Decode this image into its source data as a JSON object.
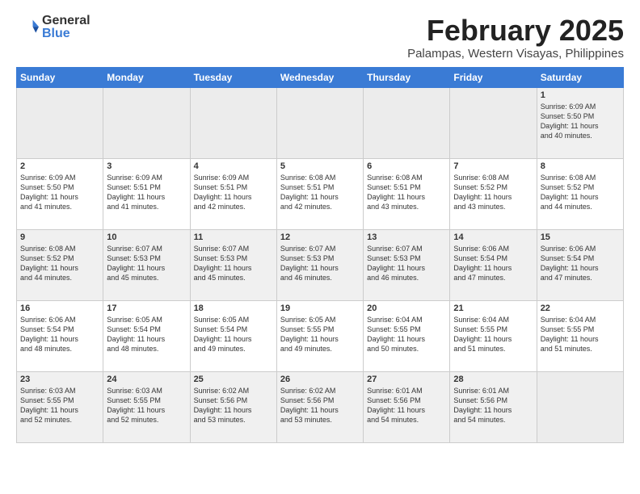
{
  "logo": {
    "general": "General",
    "blue": "Blue"
  },
  "title": "February 2025",
  "subtitle": "Palampas, Western Visayas, Philippines",
  "weekdays": [
    "Sunday",
    "Monday",
    "Tuesday",
    "Wednesday",
    "Thursday",
    "Friday",
    "Saturday"
  ],
  "weeks": [
    [
      {
        "day": "",
        "info": ""
      },
      {
        "day": "",
        "info": ""
      },
      {
        "day": "",
        "info": ""
      },
      {
        "day": "",
        "info": ""
      },
      {
        "day": "",
        "info": ""
      },
      {
        "day": "",
        "info": ""
      },
      {
        "day": "1",
        "info": "Sunrise: 6:09 AM\nSunset: 5:50 PM\nDaylight: 11 hours\nand 40 minutes."
      }
    ],
    [
      {
        "day": "2",
        "info": "Sunrise: 6:09 AM\nSunset: 5:50 PM\nDaylight: 11 hours\nand 41 minutes."
      },
      {
        "day": "3",
        "info": "Sunrise: 6:09 AM\nSunset: 5:51 PM\nDaylight: 11 hours\nand 41 minutes."
      },
      {
        "day": "4",
        "info": "Sunrise: 6:09 AM\nSunset: 5:51 PM\nDaylight: 11 hours\nand 42 minutes."
      },
      {
        "day": "5",
        "info": "Sunrise: 6:08 AM\nSunset: 5:51 PM\nDaylight: 11 hours\nand 42 minutes."
      },
      {
        "day": "6",
        "info": "Sunrise: 6:08 AM\nSunset: 5:51 PM\nDaylight: 11 hours\nand 43 minutes."
      },
      {
        "day": "7",
        "info": "Sunrise: 6:08 AM\nSunset: 5:52 PM\nDaylight: 11 hours\nand 43 minutes."
      },
      {
        "day": "8",
        "info": "Sunrise: 6:08 AM\nSunset: 5:52 PM\nDaylight: 11 hours\nand 44 minutes."
      }
    ],
    [
      {
        "day": "9",
        "info": "Sunrise: 6:08 AM\nSunset: 5:52 PM\nDaylight: 11 hours\nand 44 minutes."
      },
      {
        "day": "10",
        "info": "Sunrise: 6:07 AM\nSunset: 5:53 PM\nDaylight: 11 hours\nand 45 minutes."
      },
      {
        "day": "11",
        "info": "Sunrise: 6:07 AM\nSunset: 5:53 PM\nDaylight: 11 hours\nand 45 minutes."
      },
      {
        "day": "12",
        "info": "Sunrise: 6:07 AM\nSunset: 5:53 PM\nDaylight: 11 hours\nand 46 minutes."
      },
      {
        "day": "13",
        "info": "Sunrise: 6:07 AM\nSunset: 5:53 PM\nDaylight: 11 hours\nand 46 minutes."
      },
      {
        "day": "14",
        "info": "Sunrise: 6:06 AM\nSunset: 5:54 PM\nDaylight: 11 hours\nand 47 minutes."
      },
      {
        "day": "15",
        "info": "Sunrise: 6:06 AM\nSunset: 5:54 PM\nDaylight: 11 hours\nand 47 minutes."
      }
    ],
    [
      {
        "day": "16",
        "info": "Sunrise: 6:06 AM\nSunset: 5:54 PM\nDaylight: 11 hours\nand 48 minutes."
      },
      {
        "day": "17",
        "info": "Sunrise: 6:05 AM\nSunset: 5:54 PM\nDaylight: 11 hours\nand 48 minutes."
      },
      {
        "day": "18",
        "info": "Sunrise: 6:05 AM\nSunset: 5:54 PM\nDaylight: 11 hours\nand 49 minutes."
      },
      {
        "day": "19",
        "info": "Sunrise: 6:05 AM\nSunset: 5:55 PM\nDaylight: 11 hours\nand 49 minutes."
      },
      {
        "day": "20",
        "info": "Sunrise: 6:04 AM\nSunset: 5:55 PM\nDaylight: 11 hours\nand 50 minutes."
      },
      {
        "day": "21",
        "info": "Sunrise: 6:04 AM\nSunset: 5:55 PM\nDaylight: 11 hours\nand 51 minutes."
      },
      {
        "day": "22",
        "info": "Sunrise: 6:04 AM\nSunset: 5:55 PM\nDaylight: 11 hours\nand 51 minutes."
      }
    ],
    [
      {
        "day": "23",
        "info": "Sunrise: 6:03 AM\nSunset: 5:55 PM\nDaylight: 11 hours\nand 52 minutes."
      },
      {
        "day": "24",
        "info": "Sunrise: 6:03 AM\nSunset: 5:55 PM\nDaylight: 11 hours\nand 52 minutes."
      },
      {
        "day": "25",
        "info": "Sunrise: 6:02 AM\nSunset: 5:56 PM\nDaylight: 11 hours\nand 53 minutes."
      },
      {
        "day": "26",
        "info": "Sunrise: 6:02 AM\nSunset: 5:56 PM\nDaylight: 11 hours\nand 53 minutes."
      },
      {
        "day": "27",
        "info": "Sunrise: 6:01 AM\nSunset: 5:56 PM\nDaylight: 11 hours\nand 54 minutes."
      },
      {
        "day": "28",
        "info": "Sunrise: 6:01 AM\nSunset: 5:56 PM\nDaylight: 11 hours\nand 54 minutes."
      },
      {
        "day": "",
        "info": ""
      }
    ]
  ]
}
